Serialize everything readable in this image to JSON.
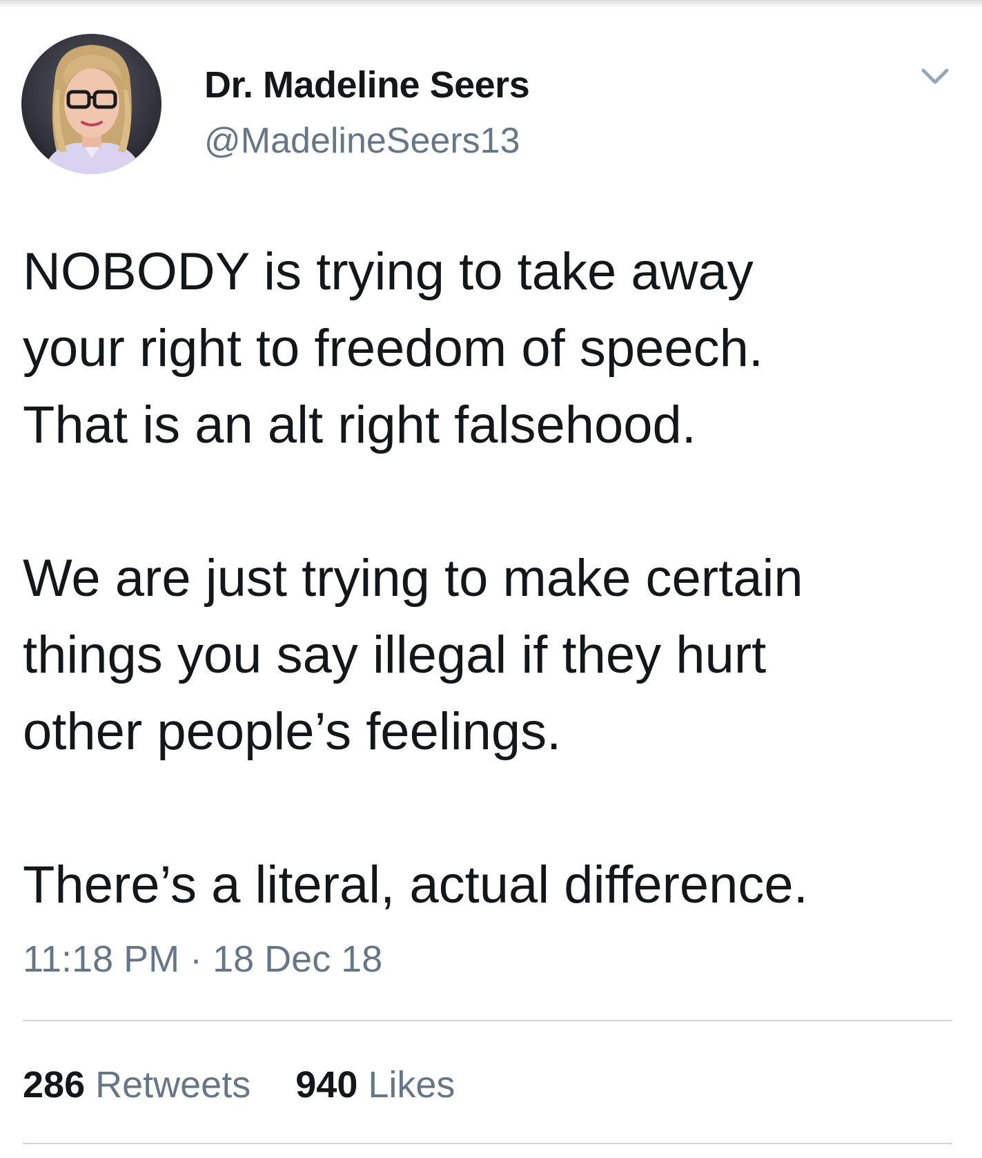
{
  "author": {
    "name": "Dr. Madeline Seers",
    "handle": "@MadelineSeers13"
  },
  "tweet": {
    "lines": [
      "NOBODY is trying to take away",
      "your right to freedom of speech.",
      "That is an alt right falsehood.",
      "We are just trying to make certain",
      "things you say illegal if they hurt",
      "other people’s feelings.",
      "There’s a literal, actual difference."
    ],
    "timestamp": "11:18 PM · 18 Dec 18"
  },
  "stats": {
    "retweets_count": "286",
    "retweets_label": "Retweets",
    "likes_count": "940",
    "likes_label": "Likes"
  },
  "icons": {
    "menu": "chevron-down-icon"
  },
  "colors": {
    "text": "#14171a",
    "secondary": "#657786",
    "divider": "#ccd6dd"
  }
}
